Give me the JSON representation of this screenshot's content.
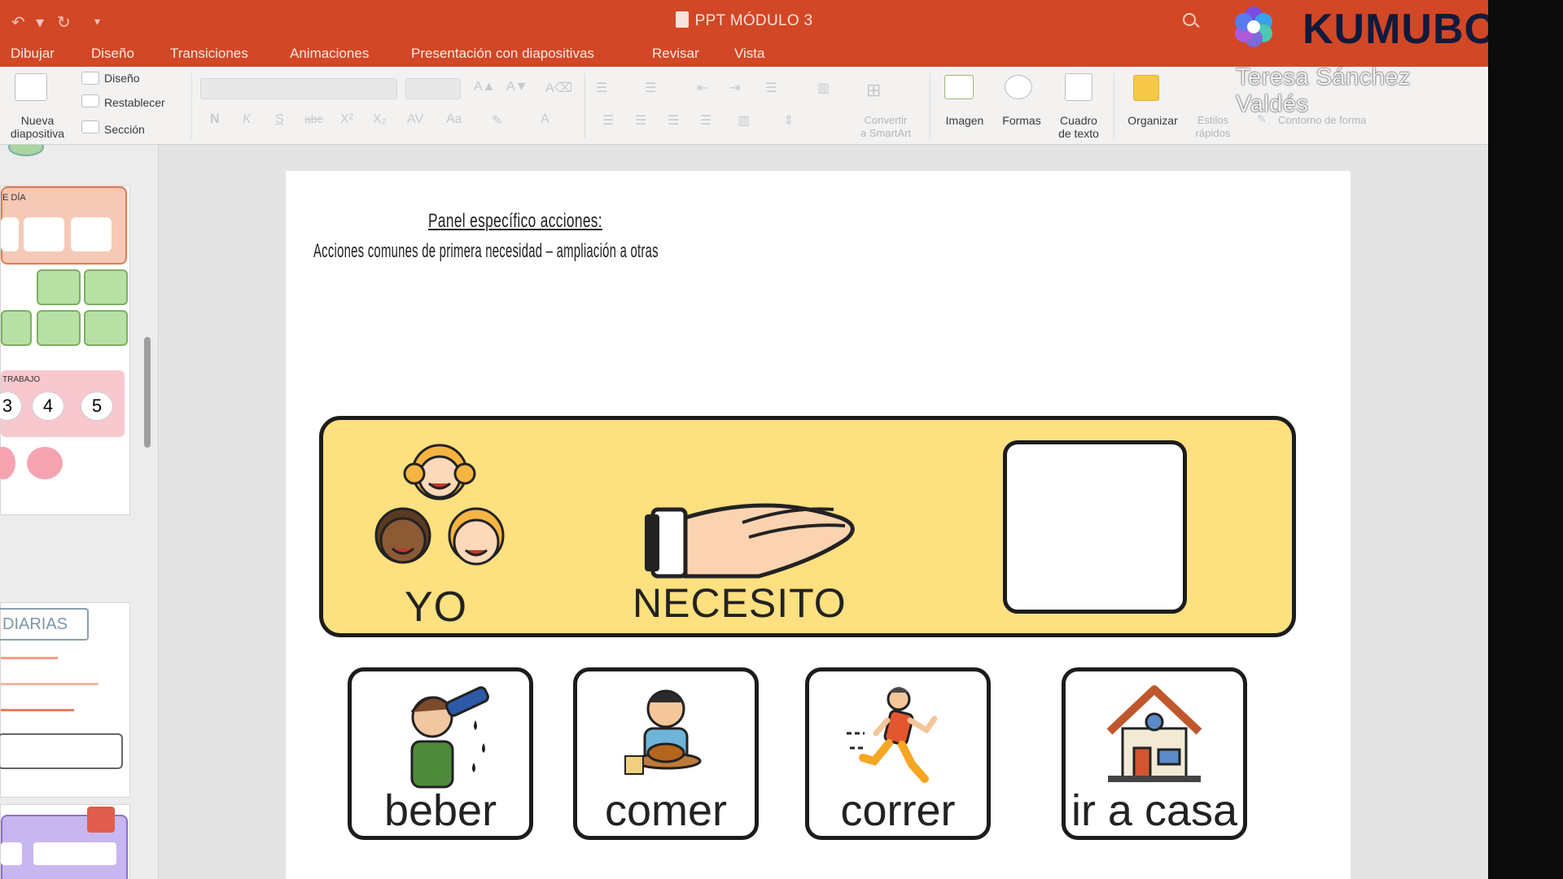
{
  "window": {
    "title": "PPT MÓDULO 3"
  },
  "menu": [
    "Dibujar",
    "Diseño",
    "Transiciones",
    "Animaciones",
    "Presentación con diapositivas",
    "Revisar",
    "Vista"
  ],
  "ribbon": {
    "new_slide": "Nueva\ndiapositiva",
    "layout": "Diseño",
    "reset": "Restablecer",
    "section": "Sección",
    "bold": "N",
    "italic": "K",
    "underline": "S",
    "strike": "abc",
    "superscript": "X²",
    "subscript": "X₂",
    "smartart": "Convertir\na SmartArt",
    "image": "Imagen",
    "shapes": "Formas",
    "textbox": "Cuadro\nde texto",
    "arrange": "Organizar",
    "quick_styles": "Estilos\nrápidos",
    "shape_outline": "Contorno de forma"
  },
  "thumbnails": {
    "t1_label": "E DÍA",
    "t2_label": "TRABAJO",
    "t2_nums": [
      "3",
      "4",
      "5"
    ],
    "t3_box": "DIARIAS"
  },
  "slide": {
    "title": "Panel específico acciones:",
    "subtitle": "Acciones comunes de primera necesidad – ampliación a otras",
    "strip": {
      "subject": "YO",
      "verb": "NECESITO"
    },
    "cards": [
      {
        "label": "beber",
        "icon": "drinking-icon"
      },
      {
        "label": "comer",
        "icon": "eating-icon"
      },
      {
        "label": "correr",
        "icon": "running-icon"
      },
      {
        "label": "ir a casa",
        "icon": "house-icon"
      }
    ]
  },
  "overlay": {
    "brand": "KUMUBOX",
    "presenter": "Teresa Sánchez Valdés"
  },
  "colors": {
    "ribbon_accent": "#d24726",
    "strip_fill": "#fde07f",
    "brand_text": "#101a3c"
  }
}
